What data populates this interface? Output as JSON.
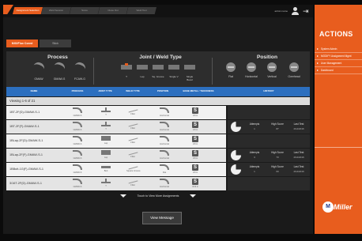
{
  "top_tabs": [
    {
      "label": "Assignment Selection",
      "active": true
    },
    {
      "label": "Weld Session",
      "active": false
    },
    {
      "label": "Score",
      "active": false
    },
    {
      "label": "Close Out",
      "active": false
    },
    {
      "label": "Weld Test",
      "active": false
    }
  ],
  "user": {
    "name": "admin name"
  },
  "sub_tabs": [
    {
      "label": "MIG/Flux Cored",
      "active": true
    },
    {
      "label": "Stick",
      "active": false
    }
  ],
  "filter": {
    "process_title": "Process",
    "joint_title": "Joint / Weld Type",
    "position_title": "Position",
    "processes": [
      "GMAW",
      "GMAW-S",
      "FCAW-G"
    ],
    "joints": [
      "T",
      "Lap",
      "Sq. Groove",
      "Single V",
      "Single Bevel"
    ],
    "positions": [
      "Flat",
      "Horizontal",
      "Vertical",
      "Overhead"
    ]
  },
  "columns": {
    "name": "NAME",
    "process": "PROCESS",
    "joint_type": "JOINT TYPE",
    "weld_type": "WELD TYPE",
    "position": "POSITION",
    "base_metal": "BASE METAL / THICKNESS",
    "history": "HISTORY"
  },
  "viewing": "Viewing 1-6 of 21",
  "rows": [
    {
      "name": "1BT-2F(D)-GMAW-S-1",
      "process": "GMAW-S",
      "joint": "T",
      "weld": "Fillet",
      "position": "Horizontal",
      "size": "1/8 in",
      "attempts": "",
      "high_score": "",
      "last_test": ""
    },
    {
      "name": "1BT-2F(F)-GMAW-S-1",
      "process": "GMAW-S",
      "joint": "T",
      "weld": "Fillet",
      "position": "Horizontal",
      "size": "1/8 in",
      "attempts": "1",
      "high_score": "87",
      "last_test": "4/14/2016"
    },
    {
      "name": "1BLap-2F(D)-GMAW-S-1",
      "process": "GMAW-S",
      "joint": "Lap",
      "weld": "Fillet",
      "position": "Horizontal",
      "size": "1/8 in",
      "attempts": "",
      "high_score": "",
      "last_test": ""
    },
    {
      "name": "1BLap-2F(F)-GMAW-S-1",
      "process": "GMAW-S",
      "joint": "Lap",
      "weld": "Fillet",
      "position": "Horizontal",
      "size": "1/8 in",
      "attempts": "3",
      "high_score": "73",
      "last_test": "4/14/2016"
    },
    {
      "name": "1BButt-1G(F)-GMAW-S-1",
      "process": "GMAW-S",
      "joint": "Butt",
      "weld": "Square Groove",
      "position": "Flat",
      "size": "1/8 in",
      "attempts": "1",
      "high_score": "60",
      "last_test": "4/14/2016"
    },
    {
      "name": "3/16T-2F(D)-GMAW-S-1",
      "process": "GMAW-S",
      "joint": "T",
      "weld": "Fillet",
      "position": "Horizontal",
      "size": "3/16 in",
      "attempts": "",
      "high_score": "",
      "last_test": ""
    }
  ],
  "history_labels": {
    "attempts": "Attempts",
    "high_score": "High Score",
    "last_test": "Last Test"
  },
  "touch_more": "Touch to View More Assignments",
  "view_message": "View Message",
  "actions": {
    "title": "ACTIONS",
    "items": [
      "System Admin",
      "MODIFY Assignment Mgmt",
      "User Management",
      "Dashboard"
    ]
  },
  "brand": {
    "name": "Miller",
    "accent": "#e85d1e",
    "header_blue": "#2c6fbf"
  }
}
